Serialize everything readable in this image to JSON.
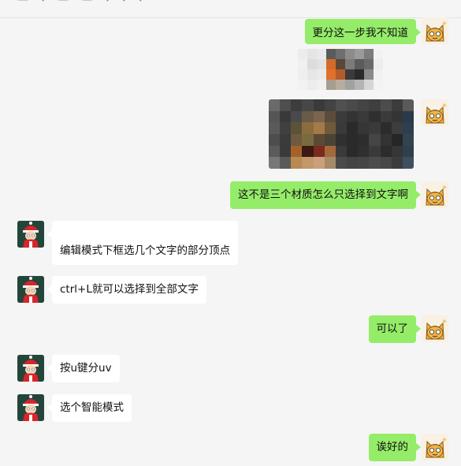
{
  "header": {
    "title": "一 · 一 一 · · ·"
  },
  "messages": [
    {
      "side": "me",
      "type": "text",
      "text": "更分这一步我不知道"
    },
    {
      "side": "me",
      "type": "image",
      "icon": "blurred-image"
    },
    {
      "side": "me",
      "type": "image",
      "icon": "blurred-image"
    },
    {
      "side": "me",
      "type": "text",
      "text": "这不是三个材质怎么只选择到文字啊"
    },
    {
      "side": "other",
      "type": "text",
      "text": "编辑模式下框选几个文字的部分顶点"
    },
    {
      "side": "other",
      "type": "text",
      "text": "ctrl+L就可以选择到全部文字"
    },
    {
      "side": "me",
      "type": "text",
      "text": "可以了"
    },
    {
      "side": "other",
      "type": "text",
      "text": "按u键分uv"
    },
    {
      "side": "other",
      "type": "text",
      "text": "选个智能模式"
    },
    {
      "side": "me",
      "type": "text",
      "text": "诶好的"
    }
  ],
  "colors": {
    "my_bubble": "#95ec69",
    "other_bubble": "#ffffff",
    "background": "#f5f5f5"
  }
}
